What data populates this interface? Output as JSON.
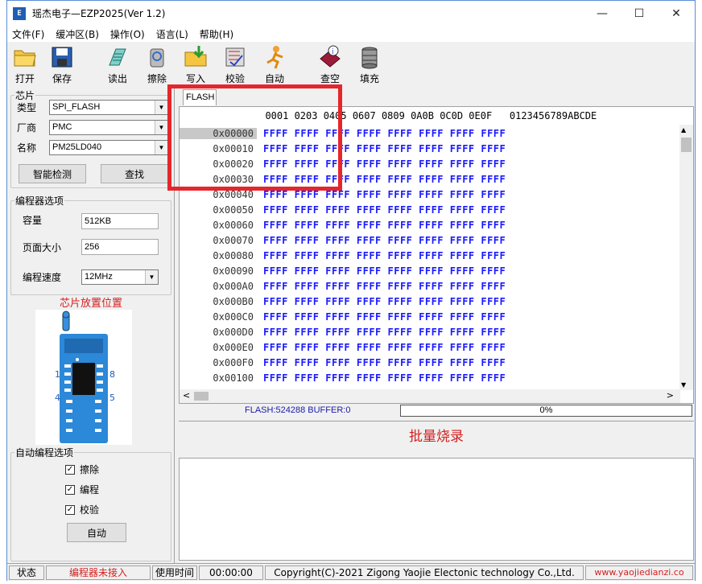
{
  "window": {
    "title": "瑶杰电子—EZP2025(Ver 1.2)",
    "icon_text": "E"
  },
  "menu": [
    "文件(F)",
    "缓冲区(B)",
    "操作(O)",
    "语言(L)",
    "帮助(H)"
  ],
  "toolbar": [
    {
      "label": "打开",
      "icon": "open-folder-icon"
    },
    {
      "label": "保存",
      "icon": "save-disk-icon"
    },
    {
      "label": "读出",
      "icon": "read-chip-icon"
    },
    {
      "label": "擦除",
      "icon": "erase-bin-icon"
    },
    {
      "label": "写入",
      "icon": "write-chip-icon"
    },
    {
      "label": "校验",
      "icon": "verify-chip-icon"
    },
    {
      "label": "自动",
      "icon": "auto-run-icon"
    },
    {
      "label": "查空",
      "icon": "blank-check-icon"
    },
    {
      "label": "填充",
      "icon": "fill-barrel-icon"
    }
  ],
  "chip": {
    "legend": "芯片",
    "type_label": "类型",
    "type_value": "SPI_FLASH",
    "vendor_label": "厂商",
    "vendor_value": "PMC",
    "name_label": "名称",
    "name_value": "PM25LD040",
    "detect_button": "智能检测",
    "find_button": "查找"
  },
  "programmer": {
    "legend": "编程器选项",
    "capacity_label": "容量",
    "capacity_value": "512KB",
    "page_label": "页面大小",
    "page_value": "256",
    "speed_label": "编程速度",
    "speed_value": "12MHz"
  },
  "placement": {
    "title": "芯片放置位置",
    "pin1": "1",
    "pin4": "4",
    "pin8": "8",
    "pin5": "5"
  },
  "auto_opts": {
    "legend": "自动编程选项",
    "erase": "擦除",
    "program": "编程",
    "verify": "校验",
    "erase_checked": true,
    "program_checked": true,
    "verify_checked": true,
    "auto_button": "自动"
  },
  "hex": {
    "tab": "FLASH",
    "header": "  0001 0203 0405 0607 0809 0A0B 0C0D 0E0F   0123456789ABCDE",
    "rows": [
      "0x00000",
      "0x00010",
      "0x00020",
      "0x00030",
      "0x00040",
      "0x00050",
      "0x00060",
      "0x00070",
      "0x00080",
      "0x00090",
      "0x000A0",
      "0x000B0",
      "0x000C0",
      "0x000D0",
      "0x000E0",
      "0x000F0",
      "0x00100"
    ],
    "row_data": "FFFF FFFF FFFF FFFF FFFF FFFF FFFF FFFF"
  },
  "info": {
    "flash_buffer": "FLASH:524288 BUFFER:0",
    "progress": "0%",
    "progress_value": 0
  },
  "batch_label": "批量烧录",
  "status": {
    "state_label": "状态",
    "state_value": "编程器未接入",
    "time_label": "使用时间",
    "time_value": "00:00:00",
    "copyright": "Copyright(C)-2021 Zigong Yaojie Electonic technology Co.,Ltd.",
    "website": "www.yaojiedianzi.co"
  },
  "colors": {
    "hex_data": "#1a1aff",
    "red_accent": "#d42020",
    "highlight_box": "#e5262b"
  }
}
